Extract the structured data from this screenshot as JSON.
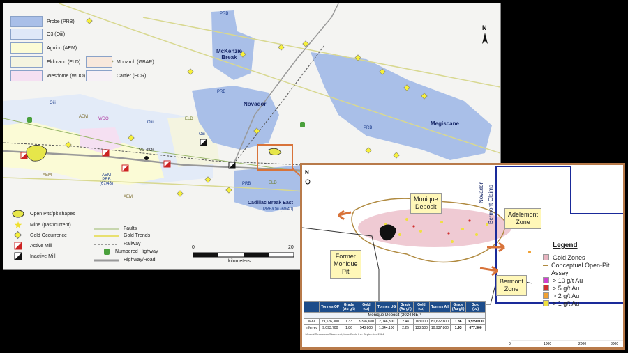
{
  "legend_top": [
    {
      "label": "Probe (PRB)",
      "color": "#a9bfe8"
    },
    {
      "label": "O3 (Oiii)",
      "color": "#dfe8f8"
    },
    {
      "label": "Agnico (AEM)",
      "color": "#fbfbd6"
    },
    {
      "label": "Eldorado (ELD)",
      "color": "#f4f4e0"
    },
    {
      "label": "Wesdome (WDO)",
      "color": "#f5e0f2"
    },
    {
      "label": "Monarch (GBAR)",
      "color": "#f8e8dc"
    },
    {
      "label": "Cartier (ECR)",
      "color": "#f6f0f6"
    }
  ],
  "legend_bottom": {
    "open_pits": "Open Pits/pit shapes",
    "mine": "Mine (past/current)",
    "gold_occ": "Gold Occurrence",
    "active_mill": "Active Mill",
    "inactive_mill": "Inactive Mill",
    "faults": "Faults",
    "gold_trends": "Gold Trends",
    "railway": "Railway",
    "numbered_highway": "Numbered Highway",
    "highway_road": "Highway/Road"
  },
  "scale": {
    "start": "0",
    "end": "20",
    "unit": "kilometers"
  },
  "north": "N",
  "map_labels": {
    "mckenzie": "McKenzie\nBreak",
    "novador": "Novador",
    "megiscane": "Megiscane",
    "cadillac": "Cadillac Break East",
    "cadillac_sub": "PRB/Oiii (60/40)",
    "prb1": "PRB",
    "prb2": "PRB",
    "prb3": "PRB",
    "prb4": "PRB",
    "aem1": "AEM",
    "aem2": "AEM",
    "aem3": "AEM",
    "aem_prb": "AEM\nPRB\n(67/43)",
    "wdo": "WDO",
    "eld1": "ELD",
    "eld2": "ELD",
    "oiii1": "Oiii",
    "oiii2": "Oiii",
    "oiii3": "Oiii",
    "val_dor": "Val-d'Or"
  },
  "inset": {
    "north": "N",
    "monique_deposit": "Monique\nDeposit",
    "former_monique": "Former\nMonique\nPit",
    "adelemont": "Adelemont\nZone",
    "bermont_zone": "Bermont\nZone",
    "novador_vert": "Novador",
    "bermont_claims_vert": "Bermont Claims",
    "legend_title": "Legend",
    "legend_items": [
      {
        "label": "Gold Zones",
        "color": "#e8b4c0"
      },
      {
        "label": "Conceptual Open-Pit",
        "color": "#b08a40"
      },
      {
        "label": "Assay",
        "color": ""
      },
      {
        "label": "> 10 g/t Au",
        "color": "#d040d0"
      },
      {
        "label": "> 5 g/t Au",
        "color": "#d03030"
      },
      {
        "label": "> 2 g/t Au",
        "color": "#f0a030"
      },
      {
        "label": "> 1 g/t Au",
        "color": "#f0e040"
      }
    ],
    "axis_ticks": [
      "0",
      "1000",
      "2000",
      "3000"
    ],
    "table": {
      "headers": [
        "",
        "Tonnes OP",
        "Grade\n(Au g/t)",
        "Gold\n(oz)",
        "Tonnes UG",
        "Grade\n(Au g/t)",
        "Gold\n(oz)",
        "Tonnes All",
        "Grade\n(Au g/t)",
        "Gold\n(oz)"
      ],
      "title": "Monique Deposit (2024 RE)¹",
      "rows": [
        [
          "M&I",
          "79,576,300",
          "1.33",
          "3,396,600",
          "2,046,300",
          "2.48",
          "163,000",
          "81,622,600",
          "1.36",
          "3,559,600"
        ],
        [
          "Inferred",
          "9,093,700",
          "1.86",
          "543,800",
          "1,844,100",
          "2.25",
          "133,500",
          "10,937,800",
          "1.93",
          "677,300"
        ]
      ],
      "footnote": "¹ Mineral Resources Statement, InnovExplo Inc. September 2024"
    }
  }
}
